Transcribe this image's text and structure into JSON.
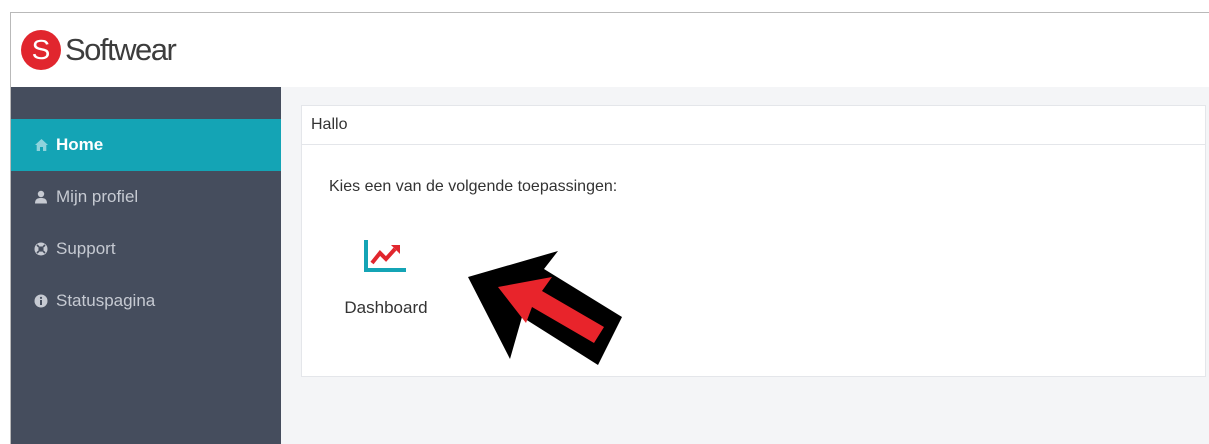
{
  "brand": {
    "logo_letter": "S",
    "name": "Softwear",
    "logo_color": "#e1262e"
  },
  "sidebar": {
    "items": [
      {
        "label": "Home",
        "icon": "home-icon",
        "active": true
      },
      {
        "label": "Mijn profiel",
        "icon": "user-icon",
        "active": false
      },
      {
        "label": "Support",
        "icon": "support-icon",
        "active": false
      },
      {
        "label": "Statuspagina",
        "icon": "info-icon",
        "active": false
      }
    ],
    "background": "#454d5d",
    "active_color": "#14a4b5"
  },
  "main": {
    "panel_title": "Hallo",
    "intro": "Kies een van de volgende toepassingen:",
    "apps": [
      {
        "label": "Dashboard",
        "icon": "dashboard-chart-icon"
      }
    ]
  },
  "annotation": {
    "icon": "arrow-pointer-icon",
    "fill_color": "#e8242b",
    "outline_color": "#000000"
  }
}
